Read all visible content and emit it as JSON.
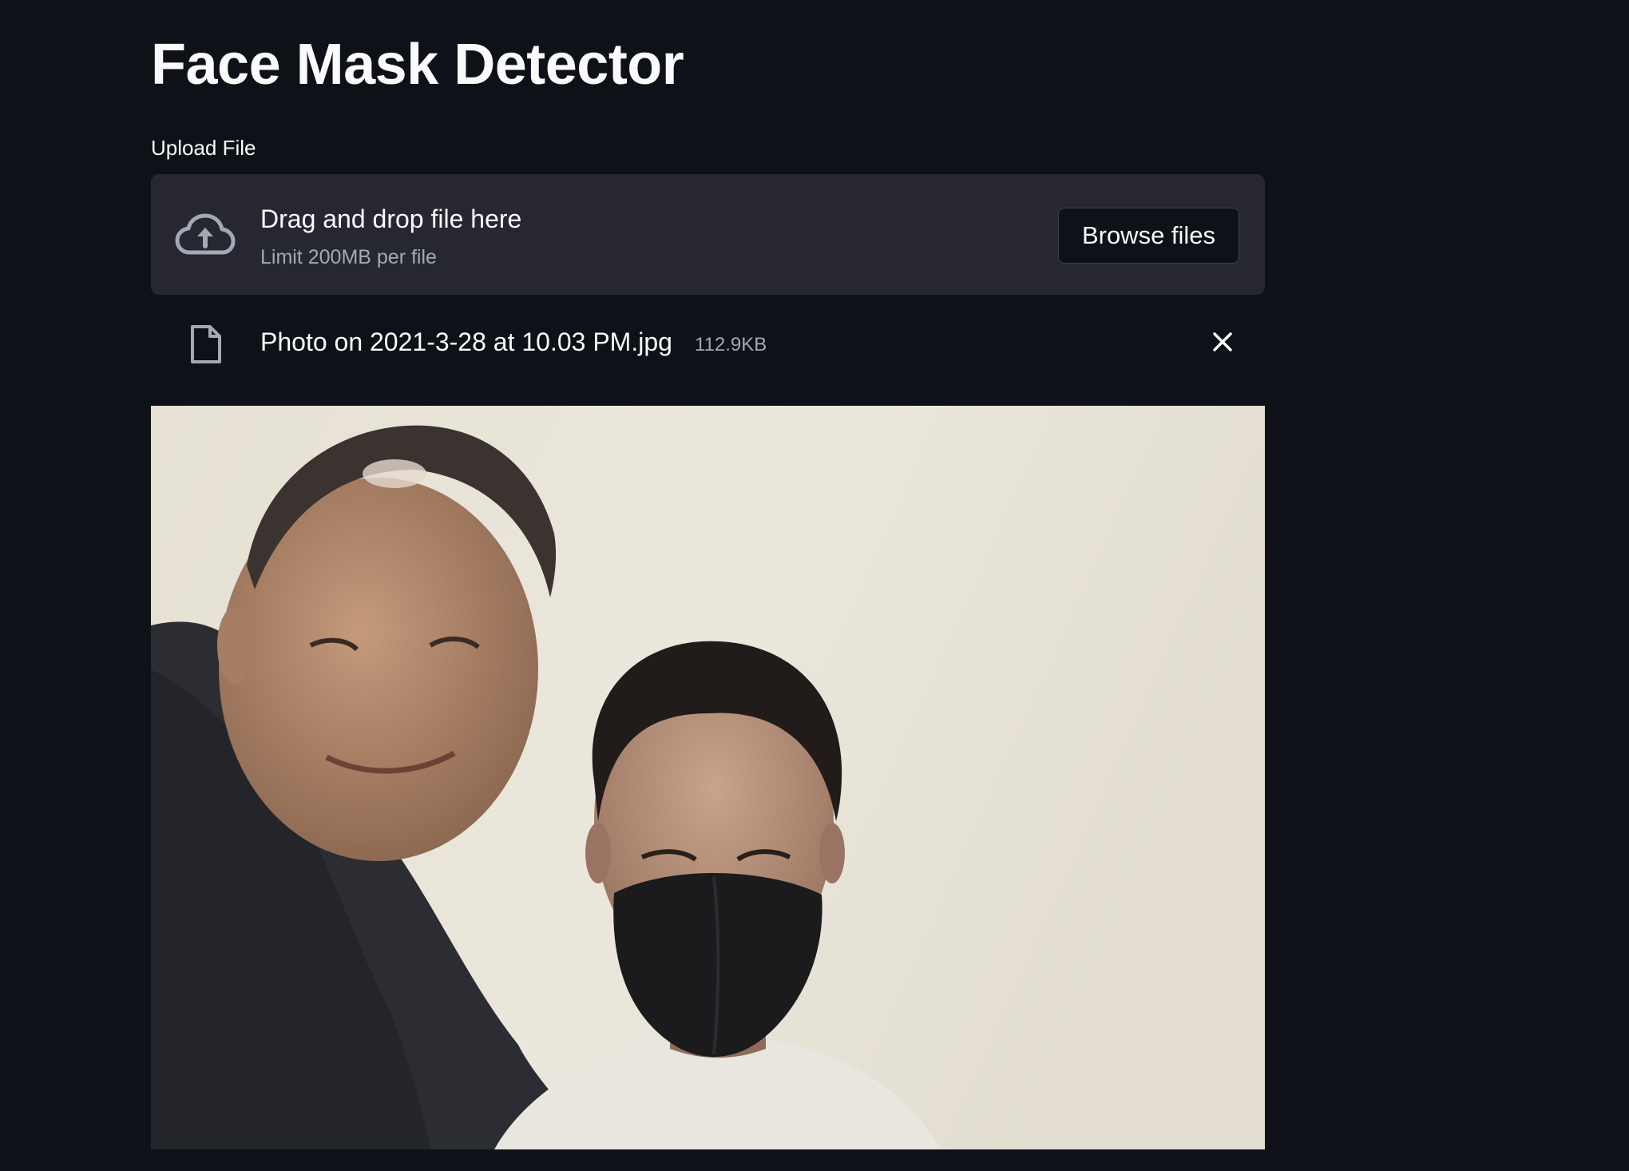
{
  "app": {
    "title": "Face Mask Detector"
  },
  "uploader": {
    "label": "Upload File",
    "dropzone_text": "Drag and drop file here",
    "limit_text": "Limit 200MB per file",
    "browse_label": "Browse files",
    "icon": "cloud-upload-icon"
  },
  "uploaded_file": {
    "name": "Photo on 2021-3-28 at 10.03 PM.jpg",
    "size": "112.9KB",
    "icon": "file-icon",
    "remove_icon": "close-icon"
  },
  "image": {
    "description_icon": "uploaded-photo"
  },
  "colors": {
    "background": "#0e1117",
    "dropzone": "#262730",
    "text": "#fafafa",
    "muted": "#a3a8b4"
  }
}
